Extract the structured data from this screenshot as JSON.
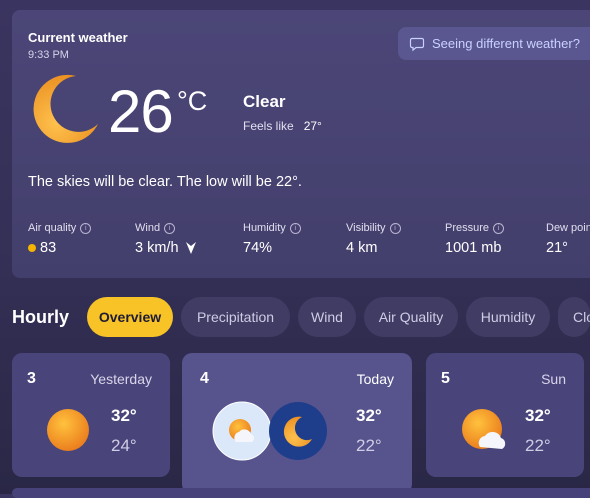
{
  "current": {
    "title": "Current weather",
    "time": "9:33 PM",
    "seeing_button": "Seeing different weather?",
    "temperature": "26",
    "unit": "°C",
    "condition": "Clear",
    "feels_label": "Feels like",
    "feels_value": "27°",
    "summary": "The skies will be clear. The low will be 22°.",
    "icon": "moon-icon"
  },
  "metrics": [
    {
      "label": "Air quality",
      "value": "83",
      "dot_color": "#f4b400"
    },
    {
      "label": "Wind",
      "value": "3 km/h",
      "arrow": "wind-direction-arrow-icon"
    },
    {
      "label": "Humidity",
      "value": "74%"
    },
    {
      "label": "Visibility",
      "value": "4 km"
    },
    {
      "label": "Pressure",
      "value": "1001 mb"
    },
    {
      "label": "Dew point",
      "value": "21°"
    }
  ],
  "hourly": {
    "label": "Hourly",
    "tabs": [
      "Overview",
      "Precipitation",
      "Wind",
      "Air Quality",
      "Humidity",
      "Cloud cover"
    ],
    "active_tab": "Overview"
  },
  "days": [
    {
      "date": "3",
      "name": "Yesterday",
      "high": "32°",
      "low": "24°",
      "icon": "sun-icon"
    },
    {
      "date": "4",
      "name": "Today",
      "high": "32°",
      "low": "22°",
      "icons": [
        "partly-cloudy-day-icon",
        "moon-icon"
      ]
    },
    {
      "date": "5",
      "name": "Sun",
      "high": "32°",
      "low": "22°",
      "icon": "partly-cloudy-day-icon"
    }
  ],
  "colors": {
    "accent_pill": "#f7c326",
    "sun": "#f5a623",
    "moon": "#f0a830",
    "today_selected_bg": "#dbe8f9",
    "night_bg": "#1e3e8c"
  }
}
